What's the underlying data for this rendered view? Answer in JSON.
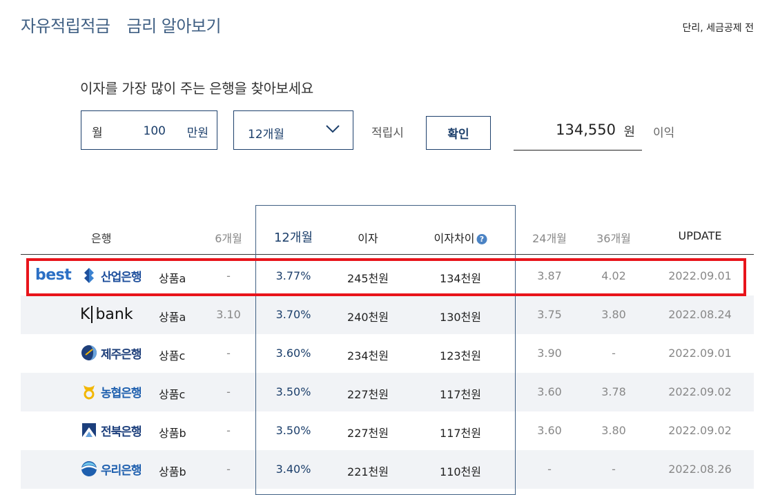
{
  "header": {
    "title_a": "자유적립적금",
    "title_b": "금리 알아보기",
    "note": "단리, 세금공제 전"
  },
  "calculator": {
    "subtitle": "이자를 가장 많이 주는 은행을 찾아보세요",
    "monthly_label": "월",
    "monthly_value": "100",
    "monthly_unit": "만원",
    "period_selected": "12개월",
    "when_label": "적립시",
    "confirm_label": "확인",
    "result_value": "134,550",
    "result_unit": "원",
    "result_suffix": "이익"
  },
  "table": {
    "headers": {
      "bank": "은행",
      "m6": "6개월",
      "m12": "12개월",
      "interest": "이자",
      "diff": "이자차이",
      "m24": "24개월",
      "m36": "36개월",
      "update": "UPDATE"
    },
    "best_label": "best",
    "rows": [
      {
        "bank": "산업은행",
        "logo": "kdb-logo-icon",
        "color": "#1e4f9c",
        "product": "상품a",
        "m6": "-",
        "m12": "3.77%",
        "interest": "245천원",
        "diff": "134천원",
        "m24": "3.87",
        "m36": "4.02",
        "update": "2022.09.01"
      },
      {
        "bank": "bank",
        "bank_prefix": "K",
        "logo": "kbank-logo-icon",
        "color": "#111111",
        "product": "상품a",
        "m6": "3.10",
        "m12": "3.70%",
        "interest": "240천원",
        "diff": "130천원",
        "m24": "3.75",
        "m36": "3.80",
        "update": "2022.08.24"
      },
      {
        "bank": "제주은행",
        "logo": "jeju-bank-logo-icon",
        "color": "#1e3f7a",
        "product": "상품c",
        "m6": "-",
        "m12": "3.60%",
        "interest": "234천원",
        "diff": "123천원",
        "m24": "3.90",
        "m36": "-",
        "update": "2022.09.01"
      },
      {
        "bank": "농협은행",
        "logo": "nh-bank-logo-icon",
        "color": "#1e5fae",
        "product": "상품c",
        "m6": "-",
        "m12": "3.50%",
        "interest": "227천원",
        "diff": "117천원",
        "m24": "3.60",
        "m36": "3.78",
        "update": "2022.09.02"
      },
      {
        "bank": "전북은행",
        "logo": "jeonbuk-bank-logo-icon",
        "color": "#1c3f7c",
        "product": "상품b",
        "m6": "-",
        "m12": "3.50%",
        "interest": "227천원",
        "diff": "117천원",
        "m24": "3.60",
        "m36": "3.80",
        "update": "2022.09.02"
      },
      {
        "bank": "우리은행",
        "logo": "woori-bank-logo-icon",
        "color": "#1e5fae",
        "product": "상품b",
        "m6": "-",
        "m12": "3.40%",
        "interest": "221천원",
        "diff": "110천원",
        "m24": "-",
        "m36": "-",
        "update": "2022.08.26"
      }
    ]
  }
}
